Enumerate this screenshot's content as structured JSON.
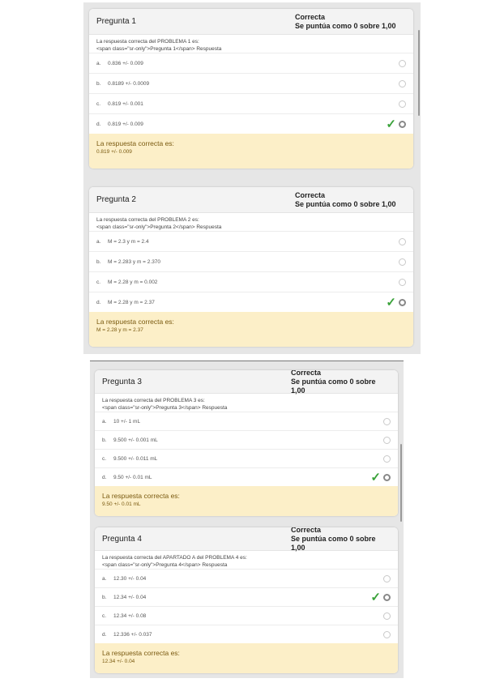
{
  "answer_label": "La respuesta correcta es:",
  "questions": [
    {
      "title": "Pregunta 1",
      "status": "Correcta",
      "score": "Se puntúa como 0 sobre 1,00",
      "prompt1": "La respuesta correcta del PROBLEMA 1 es:",
      "prompt2": "<span class=\"sr-only\">Pregunta 1</span> Respuesta",
      "options": [
        {
          "letter": "a.",
          "text": "0.836 +/- 0.009"
        },
        {
          "letter": "b.",
          "text": "0.8189 +/- 0.0009"
        },
        {
          "letter": "c.",
          "text": "0.819 +/- 0.001"
        },
        {
          "letter": "d.",
          "text": "0.819 +/- 0.009"
        }
      ],
      "selected_option": "d.",
      "correct_answer": "0.819 +/- 0.009"
    },
    {
      "title": "Pregunta 2",
      "status": "Correcta",
      "score": "Se puntúa como 0 sobre 1,00",
      "prompt1": "La respuesta correcta del PROBLEMA 2 es:",
      "prompt2": "<span class=\"sr-only\">Pregunta 2</span> Respuesta",
      "options": [
        {
          "letter": "a.",
          "text": "M = 2.3 y m = 2.4"
        },
        {
          "letter": "b.",
          "text": "M = 2.283 y m = 2.370"
        },
        {
          "letter": "c.",
          "text": "M = 2.28 y m = 0.002"
        },
        {
          "letter": "d.",
          "text": "M = 2.28 y m = 2.37"
        }
      ],
      "selected_option": "d.",
      "correct_answer": "M = 2.28 y m = 2.37"
    },
    {
      "title": "Pregunta 3",
      "status": "Correcta",
      "score": "Se puntúa como 0 sobre 1,00",
      "prompt1": "La respuesta correcta del PROBLEMA 3 es:",
      "prompt2": "<span class=\"sr-only\">Pregunta 3</span> Respuesta",
      "options": [
        {
          "letter": "a.",
          "text": "10 +/- 1 mL"
        },
        {
          "letter": "b.",
          "text": "9.500 +/- 0.001 mL"
        },
        {
          "letter": "c.",
          "text": "9.500 +/- 0.011 mL"
        },
        {
          "letter": "d.",
          "text": "9.50 +/- 0.01 mL"
        }
      ],
      "selected_option": "d.",
      "correct_answer": "9.50 +/- 0.01 mL"
    },
    {
      "title": "Pregunta 4",
      "status": "Correcta",
      "score": "Se puntúa como 0 sobre 1,00",
      "prompt1": "La respuesta correcta del APARTADO A del PROBLEMA 4 es:",
      "prompt2": "<span class=\"sr-only\">Pregunta 4</span> Respuesta",
      "options": [
        {
          "letter": "a.",
          "text": "12.30 +/- 0.04"
        },
        {
          "letter": "b.",
          "text": "12.34 +/- 0.04"
        },
        {
          "letter": "c.",
          "text": "12.34 +/- 0.08"
        },
        {
          "letter": "d.",
          "text": "12.336 +/- 0.037"
        }
      ],
      "selected_option": "b.",
      "correct_answer": "12.34 +/- 0.04"
    }
  ]
}
